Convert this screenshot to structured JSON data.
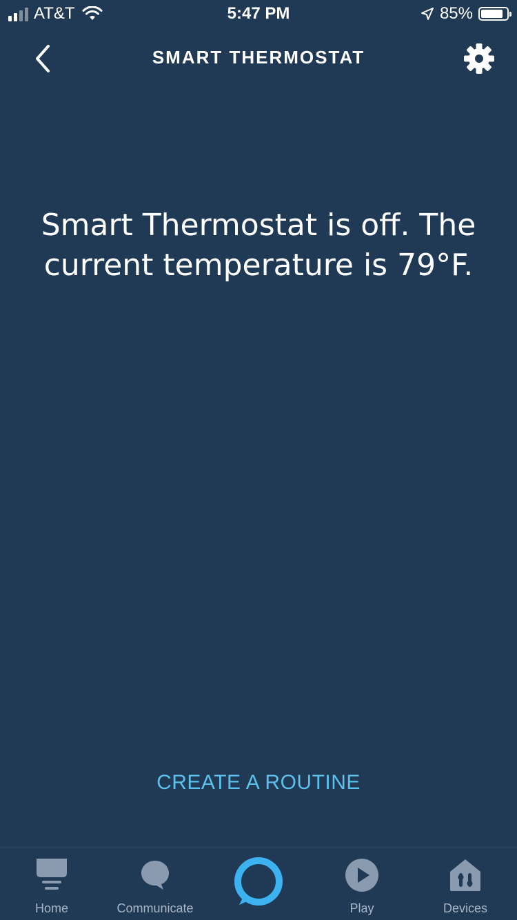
{
  "status_bar": {
    "carrier": "AT&T",
    "time": "5:47 PM",
    "battery_percent": "85%",
    "battery_level": 0.85,
    "icons": [
      "signal-icon",
      "wifi-icon",
      "location-icon",
      "battery-icon"
    ]
  },
  "nav": {
    "title": "SMART THERMOSTAT",
    "back_icon": "back-chevron-icon",
    "settings_icon": "gear-icon"
  },
  "message": "Smart Thermostat is off. The current temperature is 79°F.",
  "routine_button": "CREATE A ROUTINE",
  "tabs": [
    {
      "label": "Home",
      "icon": "home-icon"
    },
    {
      "label": "Communicate",
      "icon": "chat-bubble-icon"
    },
    {
      "label": "",
      "icon": "alexa-ring-icon"
    },
    {
      "label": "Play",
      "icon": "play-icon"
    },
    {
      "label": "Devices",
      "icon": "devices-icon"
    }
  ],
  "colors": {
    "background": "#203a55",
    "accent": "#5bc0eb",
    "tab_inactive": "#a8b6c5"
  }
}
